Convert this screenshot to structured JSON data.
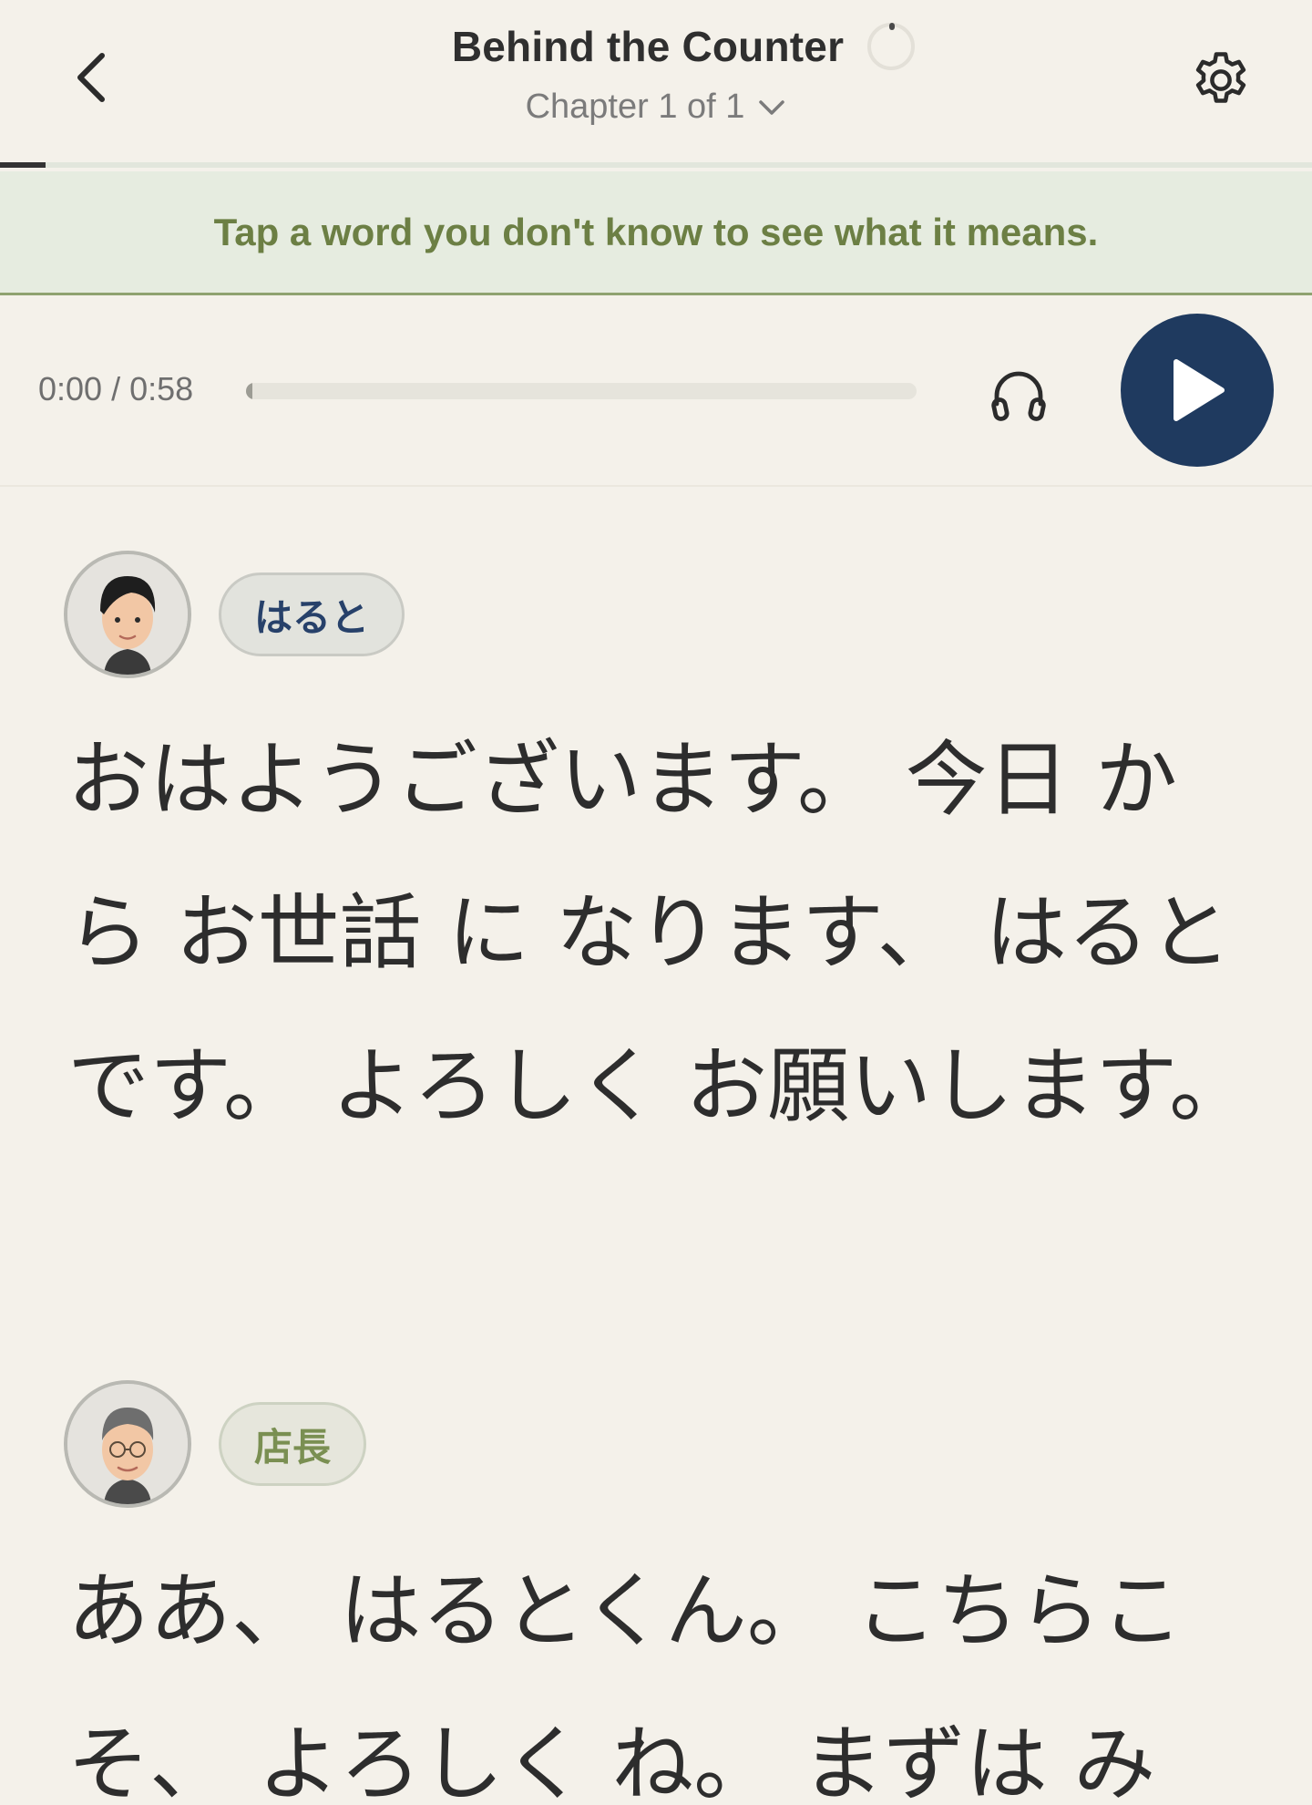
{
  "header": {
    "title": "Behind the Counter",
    "chapter_label": "Chapter 1 of 1",
    "reading_progress": 0.035
  },
  "hint": {
    "text": "Tap a word you don't know to see what it means."
  },
  "audio": {
    "time_display": "0:00 / 0:58",
    "progress": 0.0
  },
  "dialogue": [
    {
      "speaker": "はると",
      "text": "おはようございます。 今日 から お世話 に なります、 はると です。 よろしく お願いします。"
    },
    {
      "speaker": "店長",
      "text": "ああ、 はるとくん。 こちらこそ、 よろしく ね。 まずは み"
    }
  ],
  "colors": {
    "background": "#f4f1ea",
    "accent_navy": "#1f3a5f",
    "hint_green": "#6c7f44",
    "hint_background": "#e6ece0"
  },
  "icons": {
    "back": "chevron-left-icon",
    "loading": "loading-spinner-icon",
    "chapter_dropdown": "chevron-down-icon",
    "settings": "gear-icon",
    "headphones": "headphones-icon",
    "play": "play-icon"
  }
}
